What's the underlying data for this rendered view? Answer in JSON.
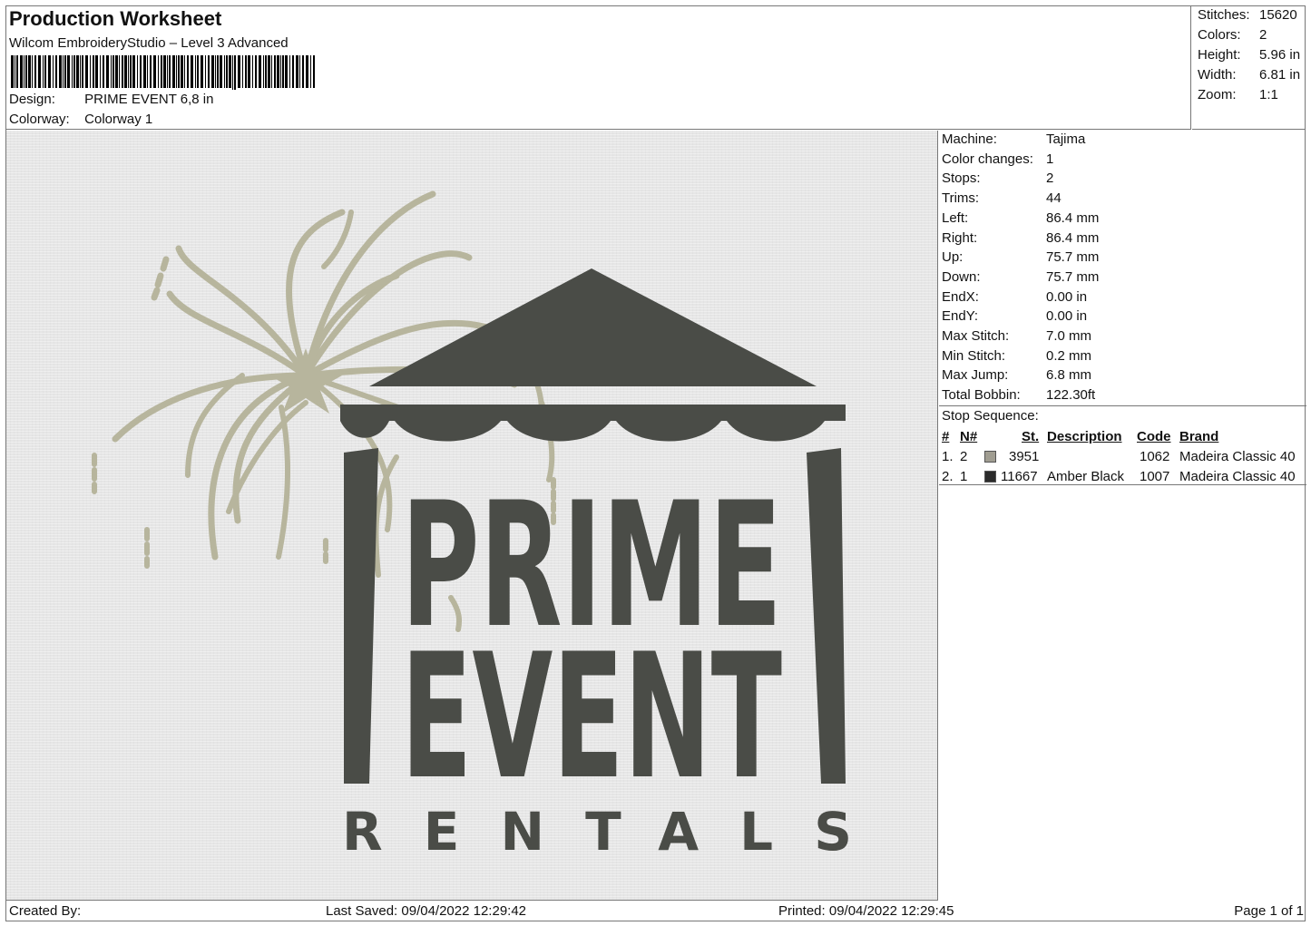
{
  "header": {
    "title": "Production Worksheet",
    "software": "Wilcom EmbroideryStudio – Level 3 Advanced",
    "design_label": "Design:",
    "design_value": "PRIME EVENT 6,8 in",
    "colorway_label": "Colorway:",
    "colorway_value": "Colorway 1"
  },
  "summary": {
    "stitches_label": "Stitches:",
    "stitches_value": "15620",
    "colors_label": "Colors:",
    "colors_value": "2",
    "height_label": "Height:",
    "height_value": "5.96 in",
    "width_label": "Width:",
    "width_value": "6.81 in",
    "zoom_label": "Zoom:",
    "zoom_value": "1:1"
  },
  "machine_info": [
    {
      "label": "Machine:",
      "value": "Tajima"
    },
    {
      "label": "Color changes:",
      "value": "1"
    },
    {
      "label": "Stops:",
      "value": "2"
    },
    {
      "label": "Trims:",
      "value": "44"
    },
    {
      "label": "Left:",
      "value": "86.4 mm"
    },
    {
      "label": "Right:",
      "value": "86.4 mm"
    },
    {
      "label": "Up:",
      "value": "75.7 mm"
    },
    {
      "label": "Down:",
      "value": "75.7 mm"
    },
    {
      "label": "EndX:",
      "value": "0.00 in"
    },
    {
      "label": "EndY:",
      "value": "0.00 in"
    },
    {
      "label": "Max Stitch:",
      "value": "7.0 mm"
    },
    {
      "label": "Min Stitch:",
      "value": "0.2 mm"
    },
    {
      "label": "Max Jump:",
      "value": "6.8 mm"
    },
    {
      "label": "Total Bobbin:",
      "value": "122.30ft"
    }
  ],
  "stop_sequence": {
    "label": "Stop Sequence:",
    "columns": [
      "#",
      "N#",
      "St.",
      "Description",
      "Code",
      "Brand"
    ],
    "rows": [
      {
        "num": "1.",
        "n": "2",
        "color": "#a09d91",
        "stitches": "3951",
        "description": "",
        "code": "1062",
        "brand": "Madeira Classic 40"
      },
      {
        "num": "2.",
        "n": "1",
        "color": "#2b2b2b",
        "stitches": "11667",
        "description": "Amber Black",
        "code": "1007",
        "brand": "Madeira Classic 40"
      }
    ]
  },
  "design_preview": {
    "line1": "PRIME",
    "line2": "EVENT",
    "line3": "RENTALS",
    "thread_dark": "#4a4c47",
    "thread_light": "#b7b59d"
  },
  "footer": {
    "created_by": "Created By:",
    "last_saved": "Last Saved: 09/04/2022 12:29:42",
    "printed": "Printed: 09/04/2022 12:29:45",
    "page": "Page 1 of 1"
  }
}
